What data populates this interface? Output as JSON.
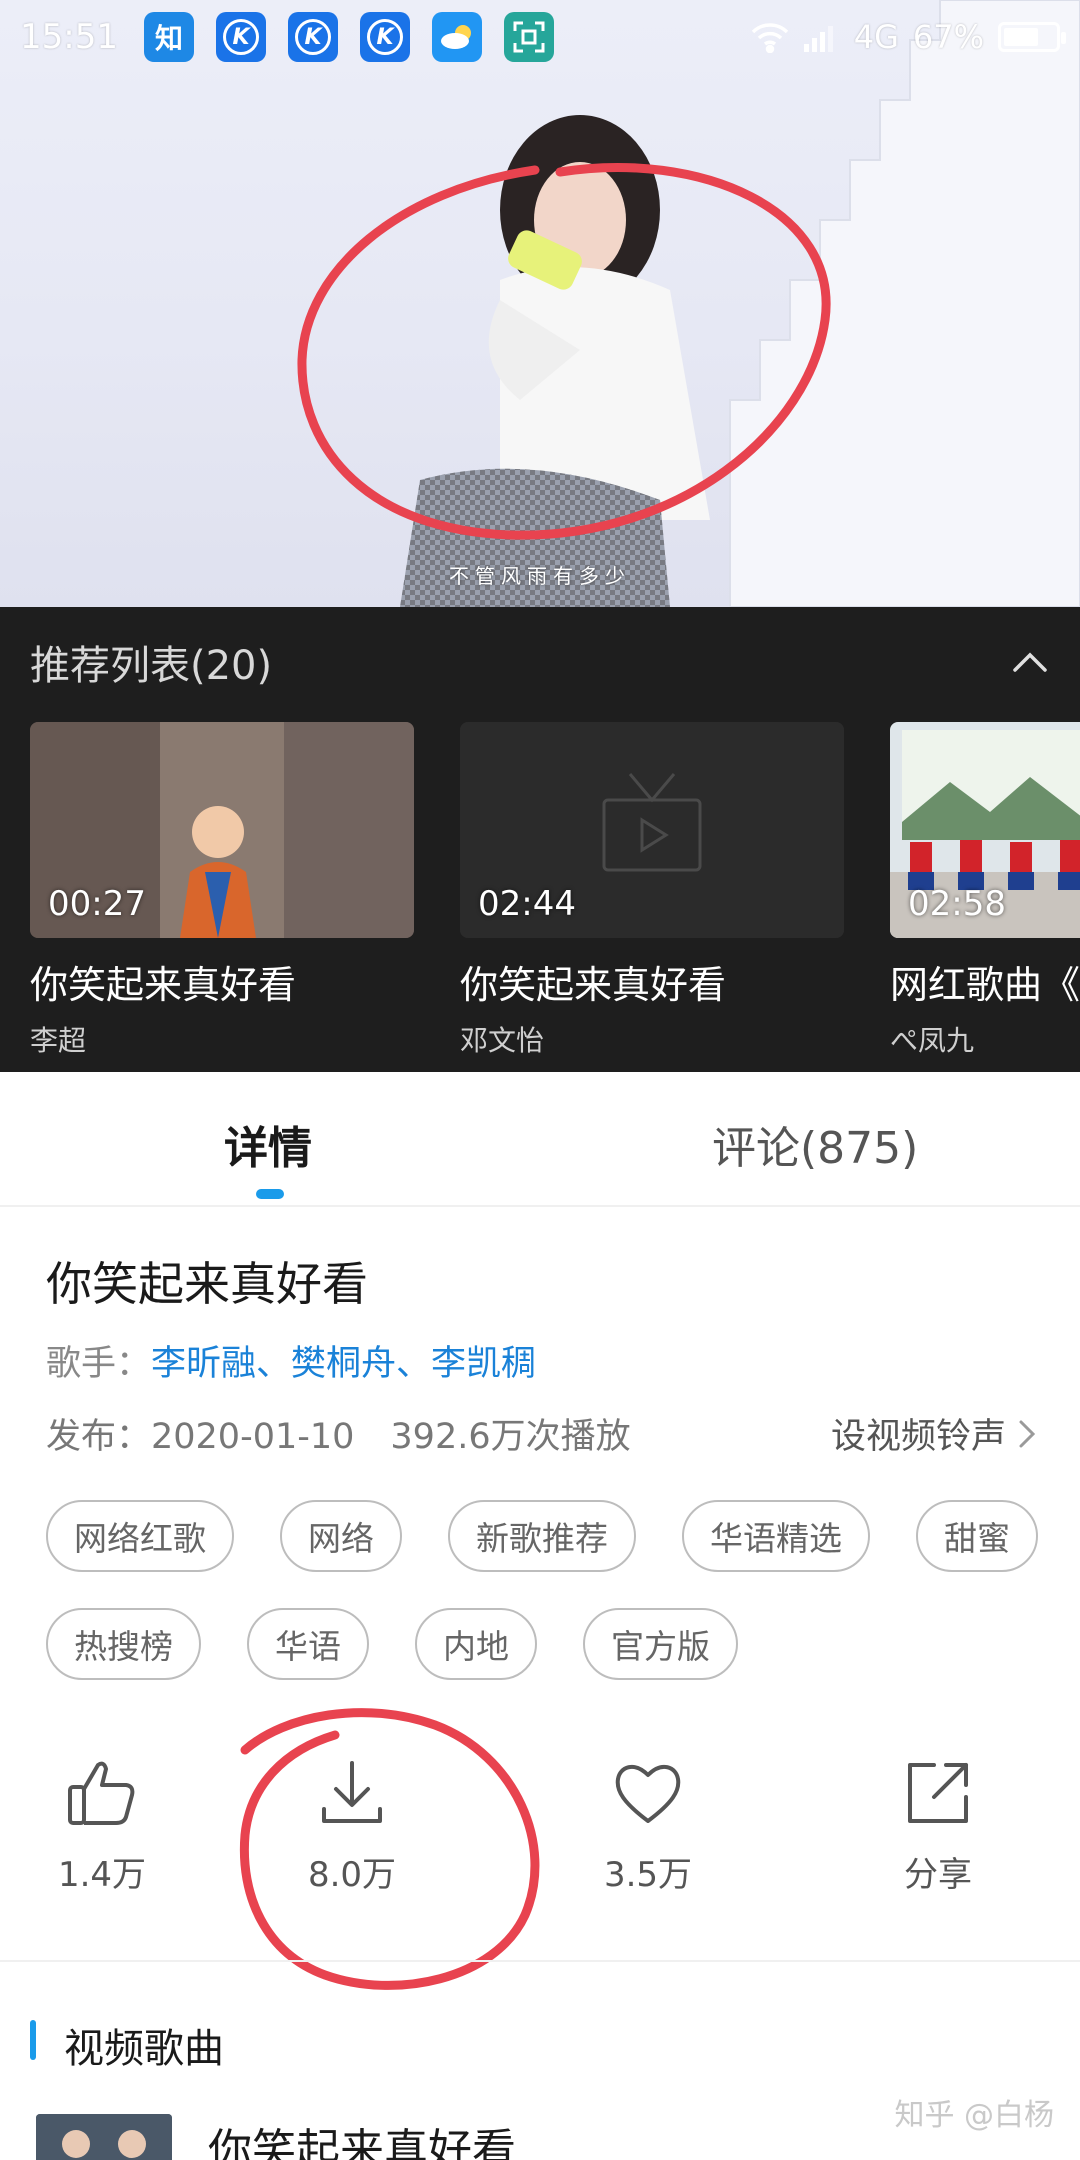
{
  "status_bar": {
    "time": "15:51",
    "network": "4G",
    "battery": "67%",
    "battery_level": 0.67,
    "app_icons": [
      {
        "name": "zhihu-app-icon",
        "label": "知"
      },
      {
        "name": "kugou-app-icon",
        "label": "K"
      },
      {
        "name": "kugou-app-icon",
        "label": "K"
      },
      {
        "name": "kugou-app-icon",
        "label": "K"
      },
      {
        "name": "weather-app-icon",
        "label": ""
      },
      {
        "name": "scanner-app-icon",
        "label": ""
      }
    ]
  },
  "video": {
    "subtitle": "不管风雨有多少"
  },
  "recommend": {
    "title": "推荐列表(20)",
    "items": [
      {
        "duration": "00:27",
        "name": "你笑起来真好看",
        "author": "李超"
      },
      {
        "duration": "02:44",
        "name": "你笑起来真好看",
        "author": "邓文怡"
      },
      {
        "duration": "02:58",
        "name": "网红歌曲《",
        "author": "ぺ凤九"
      }
    ]
  },
  "tabs": {
    "details": "详情",
    "comments": "评论(875)"
  },
  "details": {
    "title": "你笑起来真好看",
    "singer_label": "歌手：",
    "singers": "李昕融、樊桐舟、李凯稠",
    "release": "发布：2020-01-10",
    "plays": "392.6万次播放",
    "ringtone": "设视频铃声",
    "tags_row1": [
      "网络红歌",
      "网络",
      "新歌推荐",
      "华语精选",
      "甜蜜"
    ],
    "tags_row2": [
      "热搜榜",
      "华语",
      "内地",
      "官方版"
    ]
  },
  "actions": {
    "like": "1.4万",
    "download": "8.0万",
    "favorite": "3.5万",
    "share": "分享"
  },
  "section": {
    "title": "视频歌曲",
    "song_title": "你笑起来真好看"
  },
  "watermark": "知乎 @白杨",
  "colors": {
    "accent": "#1a9bea",
    "link": "#1a82d8",
    "annotation": "#e8434f",
    "panel": "#1e1e1e"
  }
}
